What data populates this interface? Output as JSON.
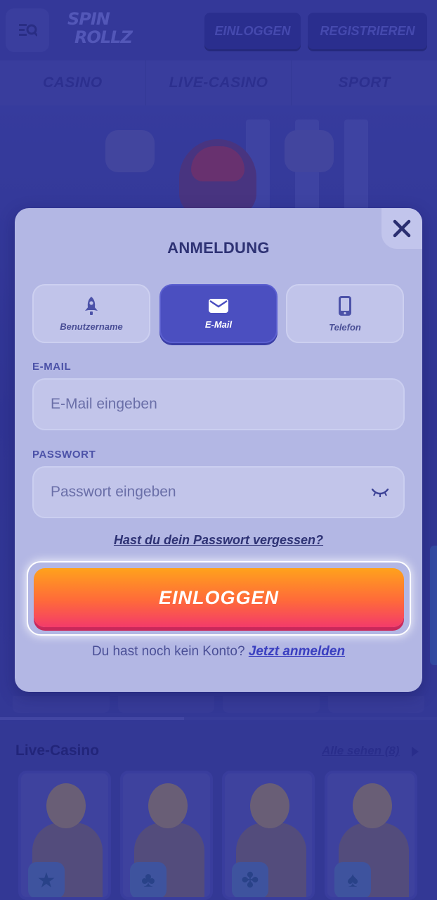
{
  "header": {
    "logo_line1": "SPIN",
    "logo_line2": "ROLLZ",
    "login_label": "EINLOGGEN",
    "register_label": "REGISTRIEREN"
  },
  "nav": {
    "items": [
      "CASINO",
      "LIVE-CASINO",
      "SPORT"
    ]
  },
  "section": {
    "title": "Live-Casino",
    "see_all": "Alle sehen (8)"
  },
  "modal": {
    "title": "ANMELDUNG",
    "tabs": [
      {
        "label": "Benutzername",
        "icon": "rocket-icon",
        "active": false
      },
      {
        "label": "E-Mail",
        "icon": "envelope-icon",
        "active": true
      },
      {
        "label": "Telefon",
        "icon": "phone-icon",
        "active": false
      }
    ],
    "email_label": "E-MAIL",
    "email_placeholder": "E-Mail eingeben",
    "email_value": "",
    "password_label": "PASSWORT",
    "password_placeholder": "Passwort eingeben",
    "password_value": "",
    "forgot_link": "Hast du dein Passwort vergessen?",
    "login_button": "EINLOGGEN",
    "signup_text": "Du hast noch kein Konto?",
    "signup_link": "Jetzt anmelden"
  },
  "live_cards": [
    {
      "suit": "★"
    },
    {
      "suit": "♣"
    },
    {
      "suit": "✤"
    },
    {
      "suit": "♠"
    }
  ],
  "colors": {
    "accent": "#4b4fc0",
    "cta_top": "#ffa21c",
    "cta_bottom": "#f33b6a",
    "modal_bg": "#b3b7e4"
  }
}
